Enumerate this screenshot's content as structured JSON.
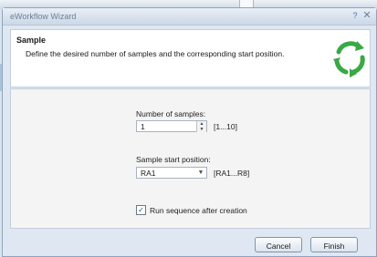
{
  "window": {
    "title": "eWorkflow Wizard",
    "help_glyph": "?",
    "close_glyph": "✕"
  },
  "header": {
    "title": "Sample",
    "description": "Define the desired number of samples and the corresponding start position."
  },
  "form": {
    "num_samples": {
      "label": "Number of samples:",
      "value": "1",
      "range": "[1...10]"
    },
    "start_position": {
      "label": "Sample start position:",
      "value": "RA1",
      "range": "[RA1...R8]"
    },
    "run_after": {
      "label": "Run sequence after creation",
      "checked": true
    }
  },
  "buttons": {
    "cancel": "Cancel",
    "finish": "Finish"
  },
  "colors": {
    "accent_green": "#3aa845",
    "title_blue": "#3f74b8"
  },
  "icons": {
    "header": "recycle-arrows-icon"
  }
}
